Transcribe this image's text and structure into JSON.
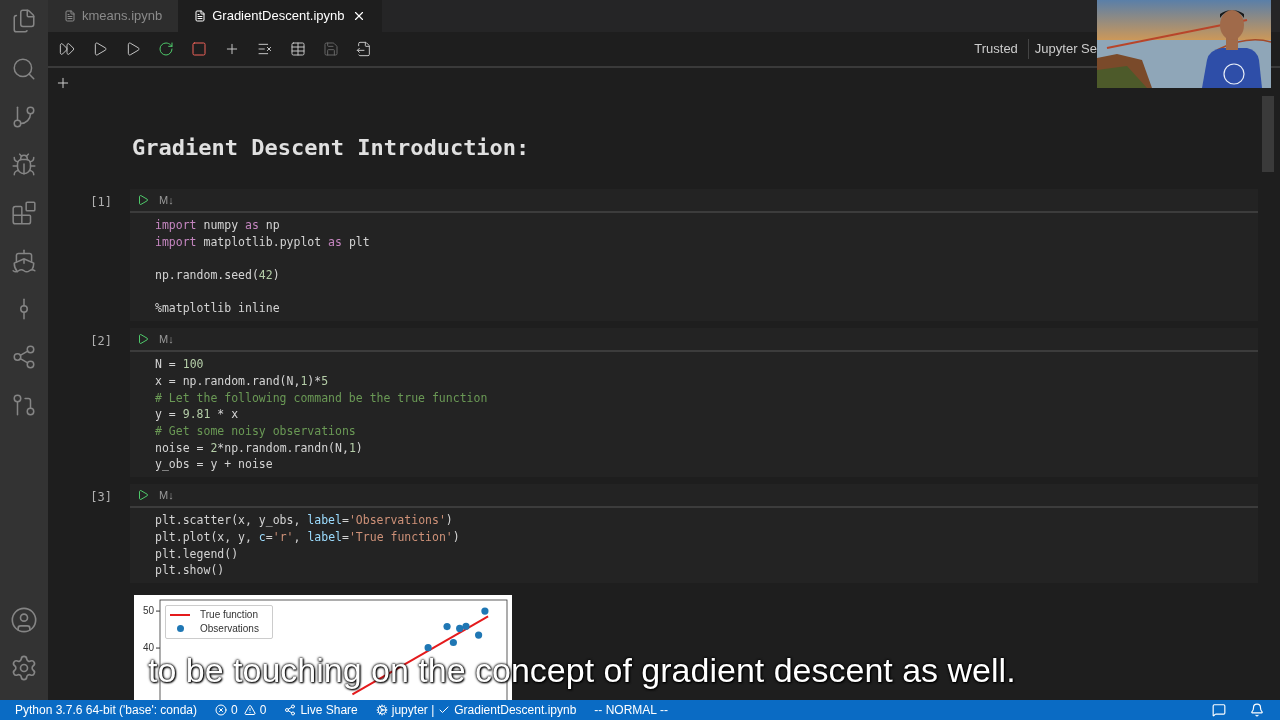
{
  "tabs": [
    {
      "label": "kmeans.ipynb",
      "selected": false
    },
    {
      "label": "GradientDescent.ipynb",
      "selected": true
    }
  ],
  "toolbar": {
    "trusted": "Trusted",
    "kernel": "Jupyter Se"
  },
  "heading": "Gradient Descent Introduction:",
  "cells": [
    {
      "count": "[1]",
      "type_label": "M↓",
      "lines": [
        {
          "tokens": [
            {
              "text": "import",
              "kind": "kw"
            },
            {
              "text": " numpy ",
              "kind": "plain"
            },
            {
              "text": "as",
              "kind": "kw"
            },
            {
              "text": " np",
              "kind": "plain"
            }
          ]
        },
        {
          "tokens": [
            {
              "text": "import",
              "kind": "kw"
            },
            {
              "text": " matplotlib.pyplot ",
              "kind": "plain"
            },
            {
              "text": "as",
              "kind": "kw"
            },
            {
              "text": " plt",
              "kind": "plain"
            }
          ]
        },
        {
          "kind": "blank"
        },
        {
          "tokens": [
            {
              "text": "np.random.seed(",
              "kind": "plain"
            },
            {
              "text": "42",
              "kind": "num"
            },
            {
              "text": ")",
              "kind": "plain"
            }
          ]
        },
        {
          "kind": "blank"
        },
        {
          "tokens": [
            {
              "text": "%matplotlib inline",
              "kind": "plain"
            }
          ]
        }
      ]
    },
    {
      "count": "[2]",
      "type_label": "M↓",
      "lines": [
        {
          "tokens": [
            {
              "text": "N = ",
              "kind": "plain"
            },
            {
              "text": "100",
              "kind": "num"
            }
          ]
        },
        {
          "tokens": [
            {
              "text": "x = np.random.rand(N,",
              "kind": "plain"
            },
            {
              "text": "1",
              "kind": "num"
            },
            {
              "text": ")*",
              "kind": "plain"
            },
            {
              "text": "5",
              "kind": "num"
            }
          ]
        },
        {
          "tokens": [
            {
              "text": "# Let the following command be the true function",
              "kind": "cmt"
            }
          ]
        },
        {
          "tokens": [
            {
              "text": "y = ",
              "kind": "plain"
            },
            {
              "text": "9.81",
              "kind": "num"
            },
            {
              "text": " * x",
              "kind": "plain"
            }
          ]
        },
        {
          "tokens": [
            {
              "text": "# Get some noisy observations",
              "kind": "cmt"
            }
          ]
        },
        {
          "tokens": [
            {
              "text": "noise = ",
              "kind": "plain"
            },
            {
              "text": "2",
              "kind": "num"
            },
            {
              "text": "*np.random.randn(N,",
              "kind": "plain"
            },
            {
              "text": "1",
              "kind": "num"
            },
            {
              "text": ")",
              "kind": "plain"
            }
          ]
        },
        {
          "tokens": [
            {
              "text": "y_obs = y + noise",
              "kind": "plain"
            }
          ]
        }
      ]
    },
    {
      "count": "[3]",
      "type_label": "M↓",
      "lines": [
        {
          "tokens": [
            {
              "text": "plt.scatter(x, y_obs, ",
              "kind": "plain"
            },
            {
              "text": "label",
              "kind": "param"
            },
            {
              "text": "=",
              "kind": "plain"
            },
            {
              "text": "'Observations'",
              "kind": "str"
            },
            {
              "text": ")",
              "kind": "plain"
            }
          ]
        },
        {
          "tokens": [
            {
              "text": "plt.plot(x, y, ",
              "kind": "plain"
            },
            {
              "text": "c",
              "kind": "param"
            },
            {
              "text": "=",
              "kind": "plain"
            },
            {
              "text": "'r'",
              "kind": "str"
            },
            {
              "text": ", ",
              "kind": "plain"
            },
            {
              "text": "label",
              "kind": "param"
            },
            {
              "text": "=",
              "kind": "plain"
            },
            {
              "text": "'True function'",
              "kind": "str"
            },
            {
              "text": ")",
              "kind": "plain"
            }
          ]
        },
        {
          "tokens": [
            {
              "text": "plt.legend()",
              "kind": "plain"
            }
          ]
        },
        {
          "tokens": [
            {
              "text": "plt.show()",
              "kind": "plain"
            }
          ]
        }
      ],
      "output": {
        "kind": "plot",
        "y_tick_labels": [
          "50",
          "40"
        ],
        "legend": [
          {
            "label": "True function",
            "kind": "line",
            "color": "#e41a1c"
          },
          {
            "label": "Observations",
            "kind": "dot",
            "color": "#1f77b4"
          }
        ]
      }
    }
  ],
  "caption": "to be touching on the concept of gradient descent as well.",
  "status_bar": {
    "interpreter": "Python 3.7.6 64-bit ('base': conda)",
    "errors": "0",
    "warnings": "0",
    "live_share": "Live Share",
    "server": "jupyter |",
    "file": "GradientDescent.ipynb",
    "mode": "-- NORMAL --"
  }
}
